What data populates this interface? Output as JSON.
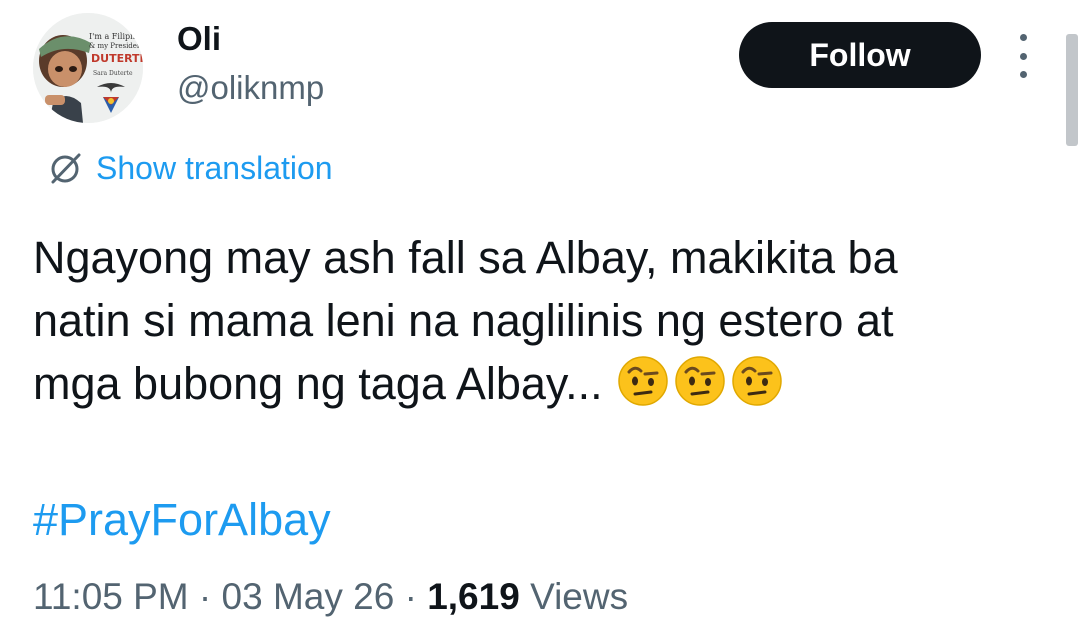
{
  "author": {
    "display_name": "Oli",
    "handle": "@oliknmp",
    "avatar_text": [
      "I'm a Filipino",
      "& my President",
      "DUTERTE",
      "Sara Duterte"
    ]
  },
  "actions": {
    "follow_label": "Follow",
    "more_icon": "more-vertical-icon"
  },
  "translation": {
    "icon": "globe-slash-icon",
    "label": "Show translation"
  },
  "tweet": {
    "lines": [
      "Ngayong may ash fall sa Albay, makikita ba",
      "natin si mama leni na naglilinis ng estero at",
      "mga bubong ng taga Albay..."
    ],
    "emoji": [
      "face-with-raised-eyebrow",
      "face-with-raised-eyebrow",
      "face-with-raised-eyebrow"
    ],
    "hashtag": "#PrayForAlbay"
  },
  "meta": {
    "time": "11:05 PM",
    "separator": "·",
    "date": "03 May 26",
    "views_count": "1,619",
    "views_label": "Views"
  },
  "colors": {
    "text": "#0f1419",
    "secondary": "#536471",
    "link": "#1d9bf0",
    "follow_bg": "#0f1419",
    "follow_text": "#ffffff"
  }
}
